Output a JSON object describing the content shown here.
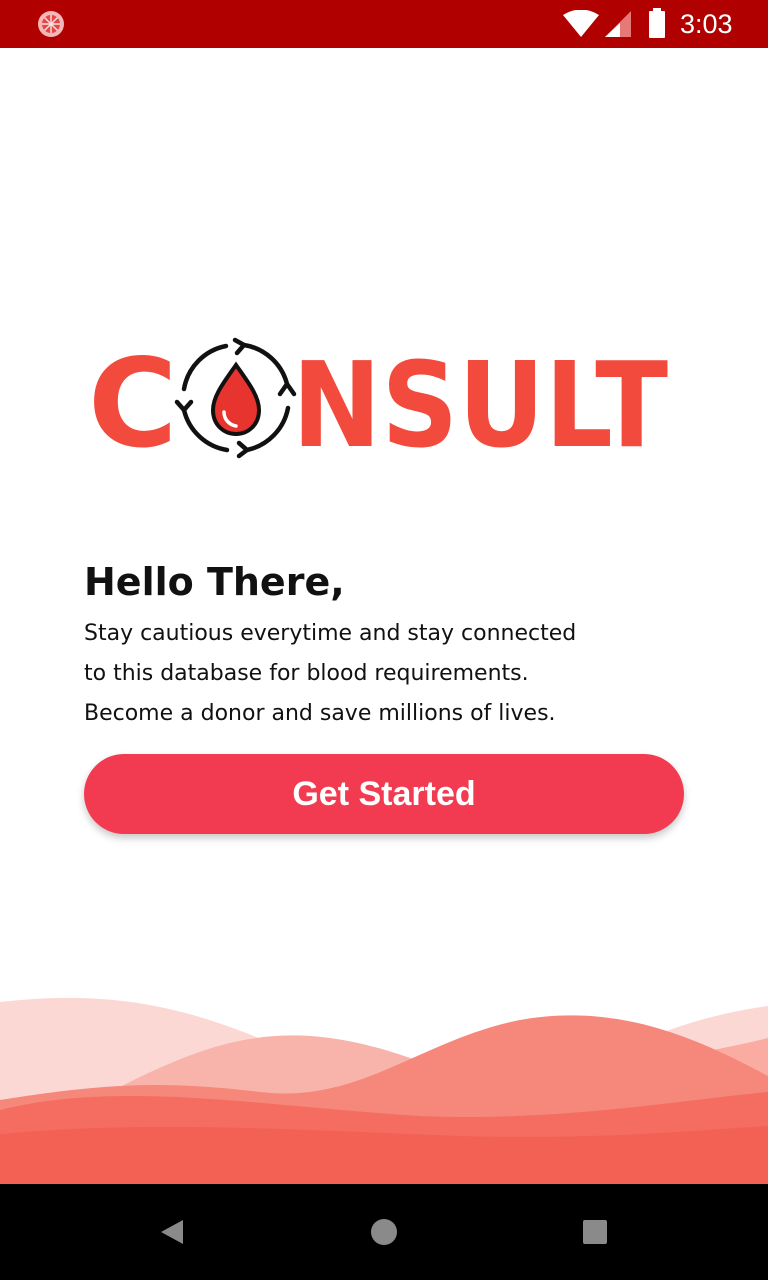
{
  "status_bar": {
    "time": "3:03",
    "background_color": "#b00000",
    "icons": [
      "app-notification-icon",
      "wifi-icon",
      "cellular-signal-icon",
      "battery-icon"
    ]
  },
  "logo": {
    "text": "CONSULT",
    "letters_before": "C",
    "letters_after": "NSULT",
    "emblem": "blood-drop-cycle-icon",
    "color": "#f24a3c"
  },
  "intro": {
    "title": "Hello There,",
    "lines": [
      "Stay cautious everytime and stay connected",
      "to this database for blood requirements.",
      "Become a donor and save millions of lives."
    ]
  },
  "cta": {
    "label": "Get Started",
    "color": "#f23b51"
  },
  "nav_bar": {
    "buttons": [
      "back-icon",
      "home-icon",
      "recents-icon"
    ]
  }
}
